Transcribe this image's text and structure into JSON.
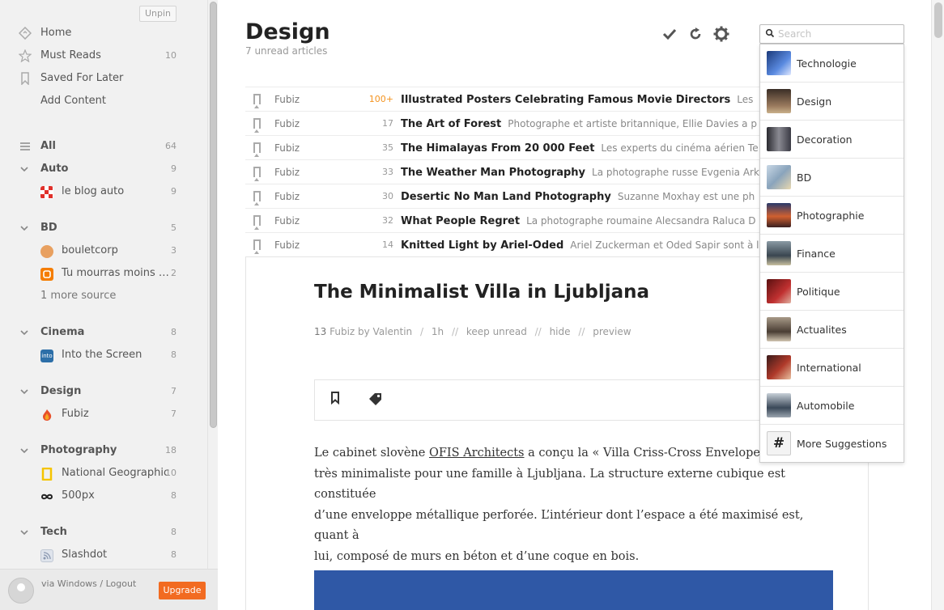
{
  "sidebar": {
    "unpin_label": "Unpin",
    "top_items": [
      {
        "label": "Home",
        "count": "",
        "icon": "home-icon"
      },
      {
        "label": "Must Reads",
        "count": "10",
        "icon": "star-icon"
      },
      {
        "label": "Saved For Later",
        "count": "",
        "icon": "bookmark-icon"
      },
      {
        "label": "Add Content",
        "count": "",
        "icon": ""
      }
    ],
    "all": {
      "label": "All",
      "count": "64"
    },
    "categories": [
      {
        "name": "Auto",
        "count": "9",
        "sources": [
          {
            "label": "le blog auto",
            "count": "9",
            "color": "#e0302a"
          }
        ],
        "more": ""
      },
      {
        "name": "BD",
        "count": "5",
        "sources": [
          {
            "label": "bouletcorp",
            "count": "3",
            "color": "#e8a060"
          },
          {
            "label": "Tu mourras moins b...",
            "count": "2",
            "color": "#f57d00"
          }
        ],
        "more": "1 more source"
      },
      {
        "name": "Cinema",
        "count": "8",
        "sources": [
          {
            "label": "Into the Screen",
            "count": "8",
            "color": "#2d6fa8"
          }
        ],
        "more": ""
      },
      {
        "name": "Design",
        "count": "7",
        "sources": [
          {
            "label": "Fubiz",
            "count": "7",
            "color": "#e8502a"
          }
        ],
        "more": ""
      },
      {
        "name": "Photography",
        "count": "18",
        "sources": [
          {
            "label": "National Geographic",
            "count": "10",
            "color": "#f5c400"
          },
          {
            "label": "500px",
            "count": "8",
            "color": "#222222"
          }
        ],
        "more": ""
      },
      {
        "name": "Tech",
        "count": "8",
        "sources": [
          {
            "label": "Slashdot",
            "count": "8",
            "color": "#a8b4c8"
          }
        ],
        "more": ""
      }
    ],
    "footer": {
      "logout_text": "via Windows / Logout",
      "upgrade_label": "Upgrade"
    }
  },
  "main": {
    "title": "Design",
    "subtitle": "7 unread articles",
    "toolbar": {
      "mark_read_icon": "check-icon",
      "refresh_icon": "refresh-icon",
      "settings_icon": "gear-icon"
    },
    "articles": [
      {
        "source": "Fubiz",
        "count": "100+",
        "hot": true,
        "title": "Illustrated Posters Celebrating Famous Movie Directors",
        "snippet": "Les"
      },
      {
        "source": "Fubiz",
        "count": "17",
        "hot": false,
        "title": "The Art of Forest",
        "snippet": "Photographe et artiste britannique, Ellie Davies a p"
      },
      {
        "source": "Fubiz",
        "count": "35",
        "hot": false,
        "title": "The Himalayas From 20 000 Feet",
        "snippet": "Les experts du cinéma aérien Te"
      },
      {
        "source": "Fubiz",
        "count": "33",
        "hot": false,
        "title": "The Weather Man Photography",
        "snippet": "La photographe russe Evgenia Ark"
      },
      {
        "source": "Fubiz",
        "count": "30",
        "hot": false,
        "title": "Desertic No Man Land Photography",
        "snippet": "Suzanne Moxhay est une ph"
      },
      {
        "source": "Fubiz",
        "count": "32",
        "hot": false,
        "title": "What People Regret",
        "snippet": "La photographe roumaine Alecsandra Raluca D"
      },
      {
        "source": "Fubiz",
        "count": "14",
        "hot": false,
        "title": "Knitted Light by Ariel-Oded",
        "snippet": "Ariel Zuckerman et Oded Sapir sont à l"
      }
    ],
    "open_article": {
      "title": "The Minimalist Villa in Ljubljana",
      "meta_count": "13",
      "meta_source": "Fubiz by Valentin",
      "meta_time": "1h",
      "meta_keep_unread": "keep unread",
      "meta_hide": "hide",
      "meta_preview": "preview",
      "meta_sep1": "/",
      "meta_sep2": "//",
      "body_pre": "Le cabinet slovène ",
      "body_link": "OFIS Architects",
      "body_line1_post": " a conçu la « Villa Criss-Cross Envelope », un",
      "body_line2": "très minimaliste pour une famille à Ljubljana. La structure externe cubique est constituée",
      "body_line3": "d’une enveloppe métallique perforée. L’intérieur dont l’espace a été maximisé est, quant à",
      "body_line4": "lui, composé de murs en béton et d’une coque en bois."
    }
  },
  "search": {
    "placeholder": "Search",
    "value": "",
    "suggestions": [
      {
        "label": "Technologie",
        "color": "#3a5aa0"
      },
      {
        "label": "Design",
        "color": "#6a5444"
      },
      {
        "label": "Decoration",
        "color": "#4a4a52"
      },
      {
        "label": "BD",
        "color": "#9ab0c4"
      },
      {
        "label": "Photographie",
        "color": "#b8502c"
      },
      {
        "label": "Finance",
        "color": "#5a6670"
      },
      {
        "label": "Politique",
        "color": "#a02828"
      },
      {
        "label": "Actualites",
        "color": "#7a6a5a"
      },
      {
        "label": "International",
        "color": "#8a2a2a"
      },
      {
        "label": "Automobile",
        "color": "#4a5868"
      }
    ],
    "more_label": "More Suggestions",
    "more_glyph": "#"
  }
}
